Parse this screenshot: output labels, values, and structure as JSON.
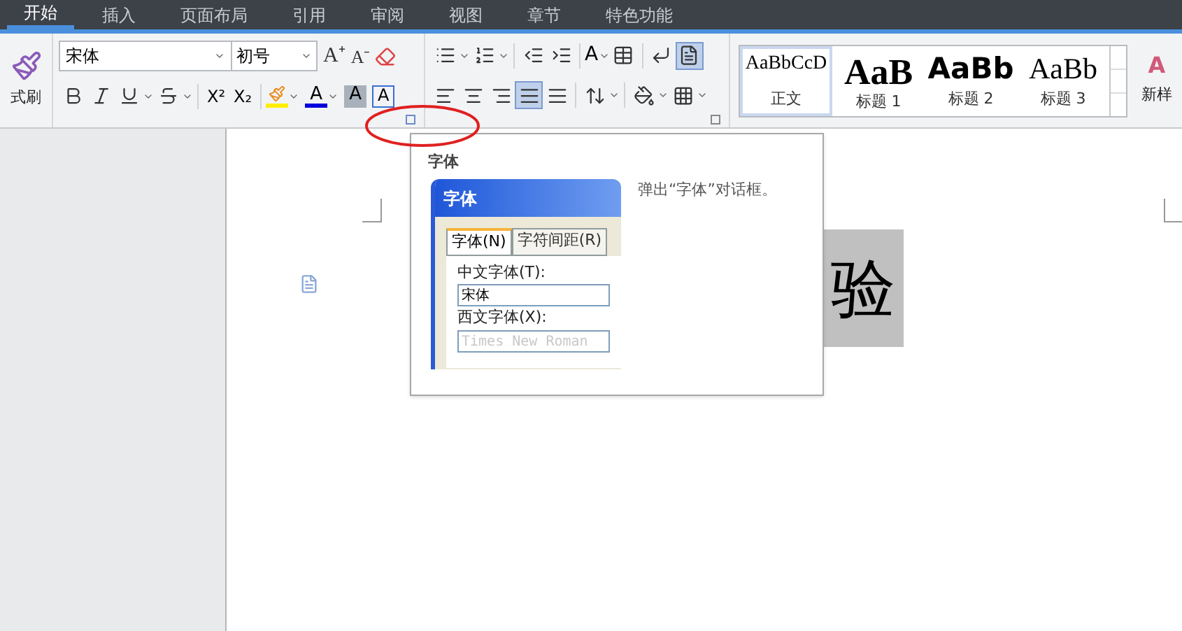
{
  "tabs": [
    {
      "label": "开始",
      "selected": true
    },
    {
      "label": "插入",
      "selected": false
    },
    {
      "label": "页面布局",
      "selected": false
    },
    {
      "label": "引用",
      "selected": false
    },
    {
      "label": "审阅",
      "selected": false
    },
    {
      "label": "视图",
      "selected": false
    },
    {
      "label": "章节",
      "selected": false
    },
    {
      "label": "特色功能",
      "selected": false
    }
  ],
  "clipboard": {
    "format_painter": "式刷"
  },
  "font": {
    "name": "宋体",
    "size": "初号",
    "grow": "A⁺",
    "shrink": "A⁻",
    "superscript": "X²",
    "subscript": "X₂",
    "font_color_glyph": "A",
    "shading": "A",
    "border": "A"
  },
  "paragraph": {
    "text_direction": "A",
    "justify_selected": true,
    "show_marks_selected": true
  },
  "new_style_icon": "A",
  "styles": [
    {
      "preview": "AaBbCcD",
      "label": "正文",
      "kind": "body",
      "selected": true
    },
    {
      "preview": "AaB",
      "label": "标题 1",
      "kind": "h1",
      "selected": false
    },
    {
      "preview": "AaBb",
      "label": "标题 2",
      "kind": "h2",
      "selected": false
    },
    {
      "preview": "AaBb",
      "label": "标题 3",
      "kind": "h3",
      "selected": false
    }
  ],
  "new_style": "新样",
  "tooltip": {
    "title": "字体",
    "description": "弹出“字体”对话框。",
    "dialog": {
      "title": "字体",
      "tabs": [
        {
          "label": "字体(N)",
          "selected": true
        },
        {
          "label": "字符间距(R)",
          "selected": false
        }
      ],
      "fields": [
        {
          "label": "中文字体(T):",
          "value": "宋体",
          "disabled": false
        },
        {
          "label": "西文字体(X):",
          "value": "Times New Roman",
          "disabled": true
        }
      ]
    }
  },
  "document": {
    "text": "验"
  }
}
